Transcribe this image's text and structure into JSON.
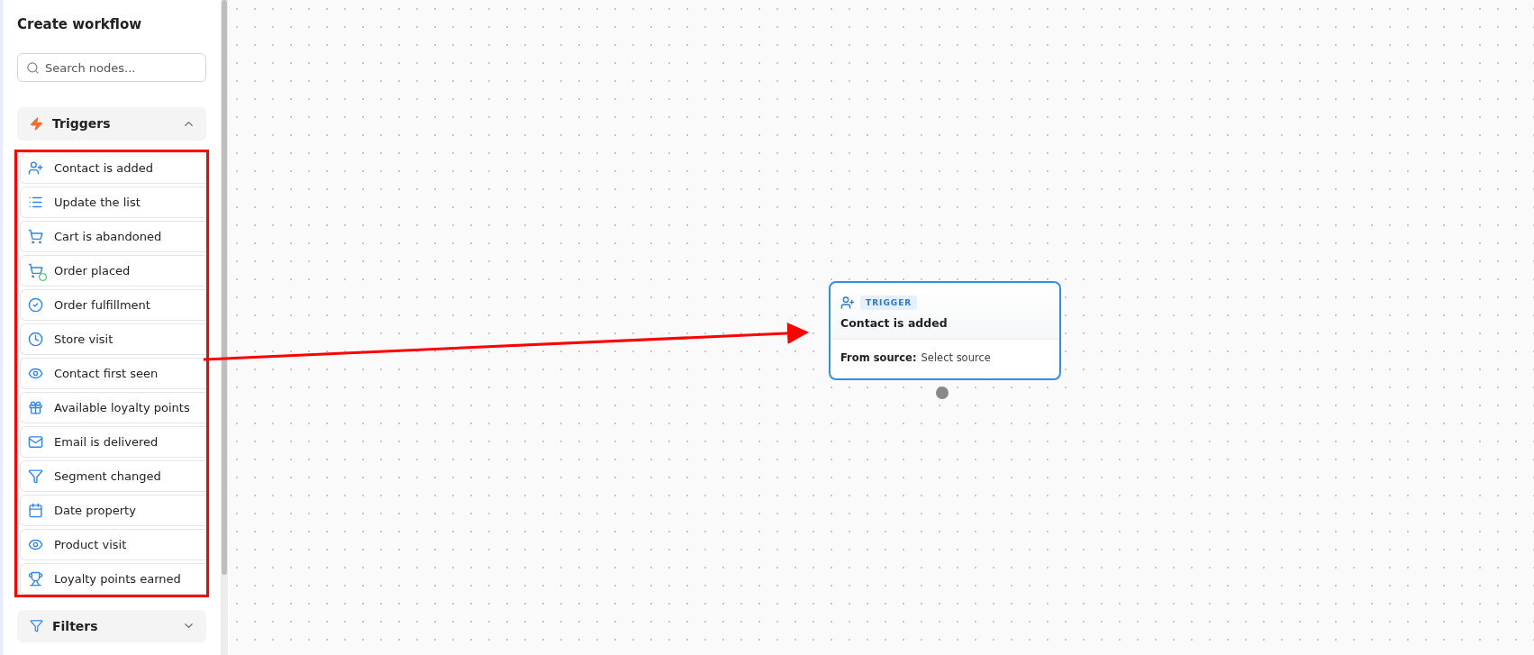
{
  "sidebar": {
    "title": "Create workflow",
    "search": {
      "placeholder": "Search nodes..."
    },
    "sections": [
      {
        "label": "Triggers",
        "expanded": true,
        "items": [
          {
            "label": "Contact is added"
          },
          {
            "label": "Update the list"
          },
          {
            "label": "Cart is abandoned"
          },
          {
            "label": "Order placed"
          },
          {
            "label": "Order fulfillment"
          },
          {
            "label": "Store visit"
          },
          {
            "label": "Contact first seen"
          },
          {
            "label": "Available loyalty points"
          },
          {
            "label": "Email is delivered"
          },
          {
            "label": "Segment changed"
          },
          {
            "label": "Date property"
          },
          {
            "label": "Product visit"
          },
          {
            "label": "Loyalty points earned"
          }
        ]
      },
      {
        "label": "Filters",
        "expanded": false
      }
    ]
  },
  "canvas": {
    "node": {
      "badge": "TRIGGER",
      "title": "Contact is added",
      "field_label": "From source:",
      "field_value": "Select source",
      "selected": true
    }
  }
}
